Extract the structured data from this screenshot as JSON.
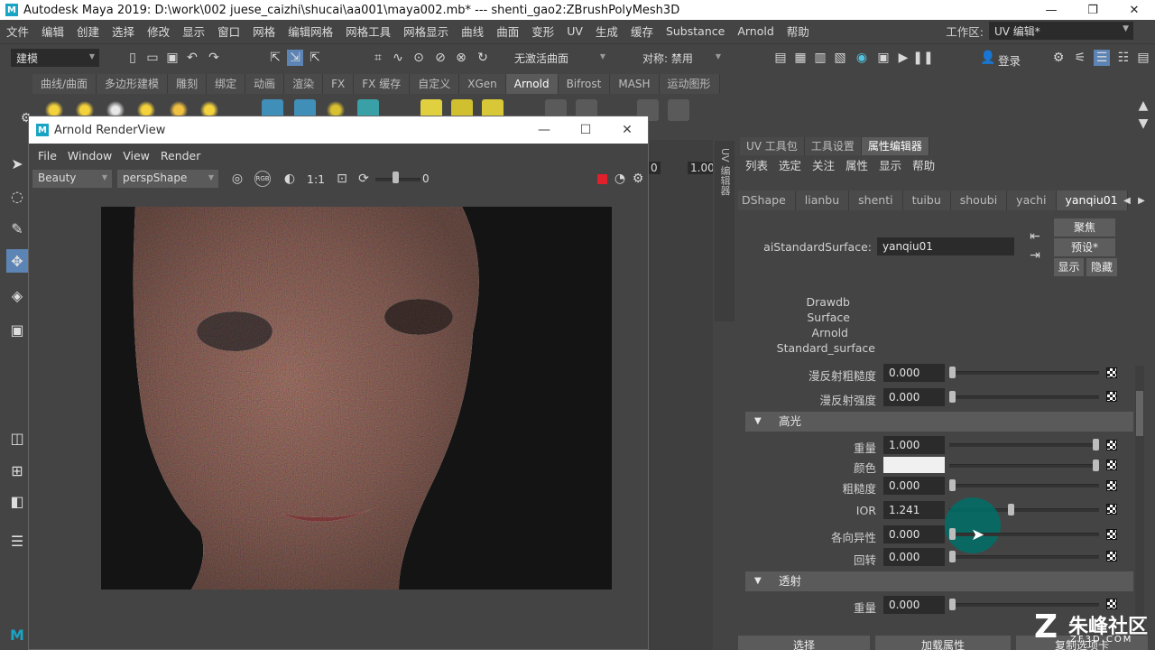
{
  "title_bar": {
    "logo": "M",
    "title": "Autodesk Maya 2019: D:\\work\\002 juese_caizhi\\shucai\\aa001\\maya002.mb*   ---   shenti_gao2:ZBrushPolyMesh3D",
    "minimize": "—",
    "maximize": "❐",
    "close": "✕"
  },
  "menu_bar": {
    "items": [
      "文件",
      "编辑",
      "创建",
      "选择",
      "修改",
      "显示",
      "窗口",
      "网格",
      "编辑网格",
      "网格工具",
      "网格显示",
      "曲线",
      "曲面",
      "变形",
      "UV",
      "生成",
      "缓存",
      "Substance",
      "Arnold",
      "帮助"
    ],
    "workspace_label": "工作区:",
    "workspace_value": "UV 编辑*"
  },
  "status_line": {
    "mode": "建模",
    "live_surface": "无激活曲面",
    "symmetry": "对称: 禁用",
    "login": "登录"
  },
  "shelf": {
    "tabs": [
      "曲线/曲面",
      "多边形建模",
      "雕刻",
      "绑定",
      "动画",
      "渲染",
      "FX",
      "FX 缓存",
      "自定义",
      "XGen",
      "Arnold",
      "Bifrost",
      "MASH",
      "运动图形"
    ],
    "active_tab": "Arnold"
  },
  "render_view": {
    "logo": "M",
    "title": "Arnold RenderView",
    "minimize": "—",
    "maximize": "☐",
    "close": "✕",
    "menu": [
      "File",
      "Window",
      "View",
      "Render"
    ],
    "aov": "Beauty",
    "camera": "perspShape",
    "ratio": "1:1",
    "exposure": "0",
    "rgb": "RGB"
  },
  "viewport_strip": {
    "value_a": "0",
    "value_b": "1.00"
  },
  "right_panel": {
    "side_tab": "UV 编辑器",
    "tabs": [
      "UV 工具包",
      "工具设置",
      "属性编辑器"
    ],
    "active_tab": "属性编辑器",
    "menu": [
      "列表",
      "选定",
      "关注",
      "属性",
      "显示",
      "帮助"
    ],
    "node_tabs": [
      "DShape",
      "lianbu",
      "shenti",
      "tuibu",
      "shoubi",
      "yachi",
      "yanqiu01"
    ],
    "active_node": "yanqiu01",
    "node_type_label": "aiStandardSurface:",
    "node_name": "yanqiu01",
    "focus_button": "聚焦",
    "preset_button": "预设*",
    "show_button": "显示",
    "hide_button": "隐藏",
    "classification": [
      "Drawdb",
      "Surface",
      "Arnold",
      "Standard_surface"
    ],
    "diffuse_roughness_label": "漫反射粗糙度",
    "diffuse_roughness_value": "0.000",
    "diffuse_strength_label": "漫反射强度",
    "diffuse_strength_value": "0.000",
    "specular_section": "高光",
    "spec_weight_label": "重量",
    "spec_weight_value": "1.000",
    "spec_color_label": "颜色",
    "spec_color_value": "#f0f0f0",
    "spec_roughness_label": "粗糙度",
    "spec_roughness_value": "0.000",
    "ior_label": "IOR",
    "ior_value": "1.241",
    "anisotropy_label": "各向异性",
    "anisotropy_value": "0.000",
    "rotation_label": "回转",
    "rotation_value": "0.000",
    "transmission_section": "透射",
    "trans_weight_label": "重量",
    "trans_weight_value": "0.000",
    "bottom_select": "选择",
    "bottom_load": "加载属性",
    "bottom_copy": "复制选项卡"
  },
  "watermark": {
    "logo": "Z",
    "text": "朱峰社区",
    "sub": "ZF3D.COM"
  }
}
